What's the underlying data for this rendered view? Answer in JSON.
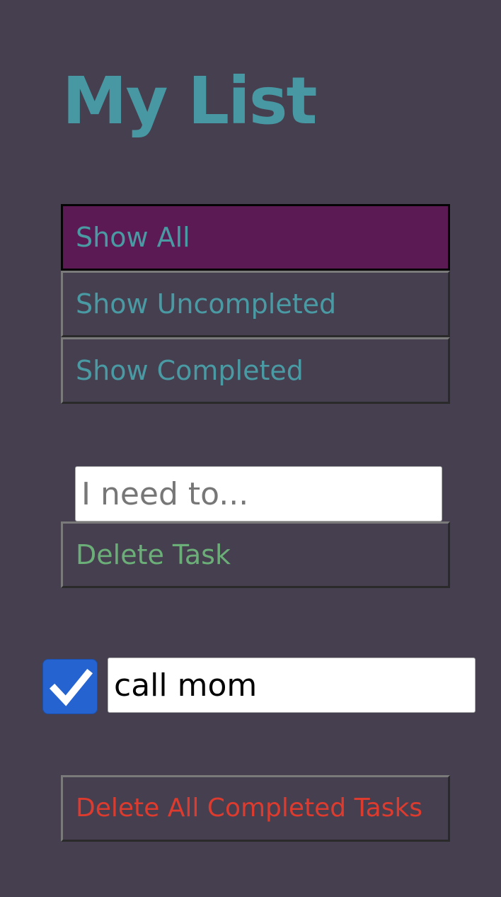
{
  "app": {
    "title": "My List"
  },
  "filters": [
    {
      "label": "Show All",
      "active": true
    },
    {
      "label": "Show Uncompleted",
      "active": false
    },
    {
      "label": "Show Completed",
      "active": false
    }
  ],
  "new_task": {
    "placeholder": "I need to...",
    "value": ""
  },
  "delete_task_label": "Delete Task",
  "tasks": [
    {
      "text": "call mom",
      "completed": true
    }
  ],
  "delete_all_completed_label": "Delete All Completed Tasks",
  "colors": {
    "background": "#453f50",
    "title": "#4798a2",
    "filter_text": "#4a9aa4",
    "active_filter_bg": "#5c1a54",
    "delete_task_text": "#6cae78",
    "delete_all_text": "#dd3b2e",
    "checkbox": "#2563d0"
  },
  "icons": {
    "checkbox": "checkmark-icon"
  }
}
